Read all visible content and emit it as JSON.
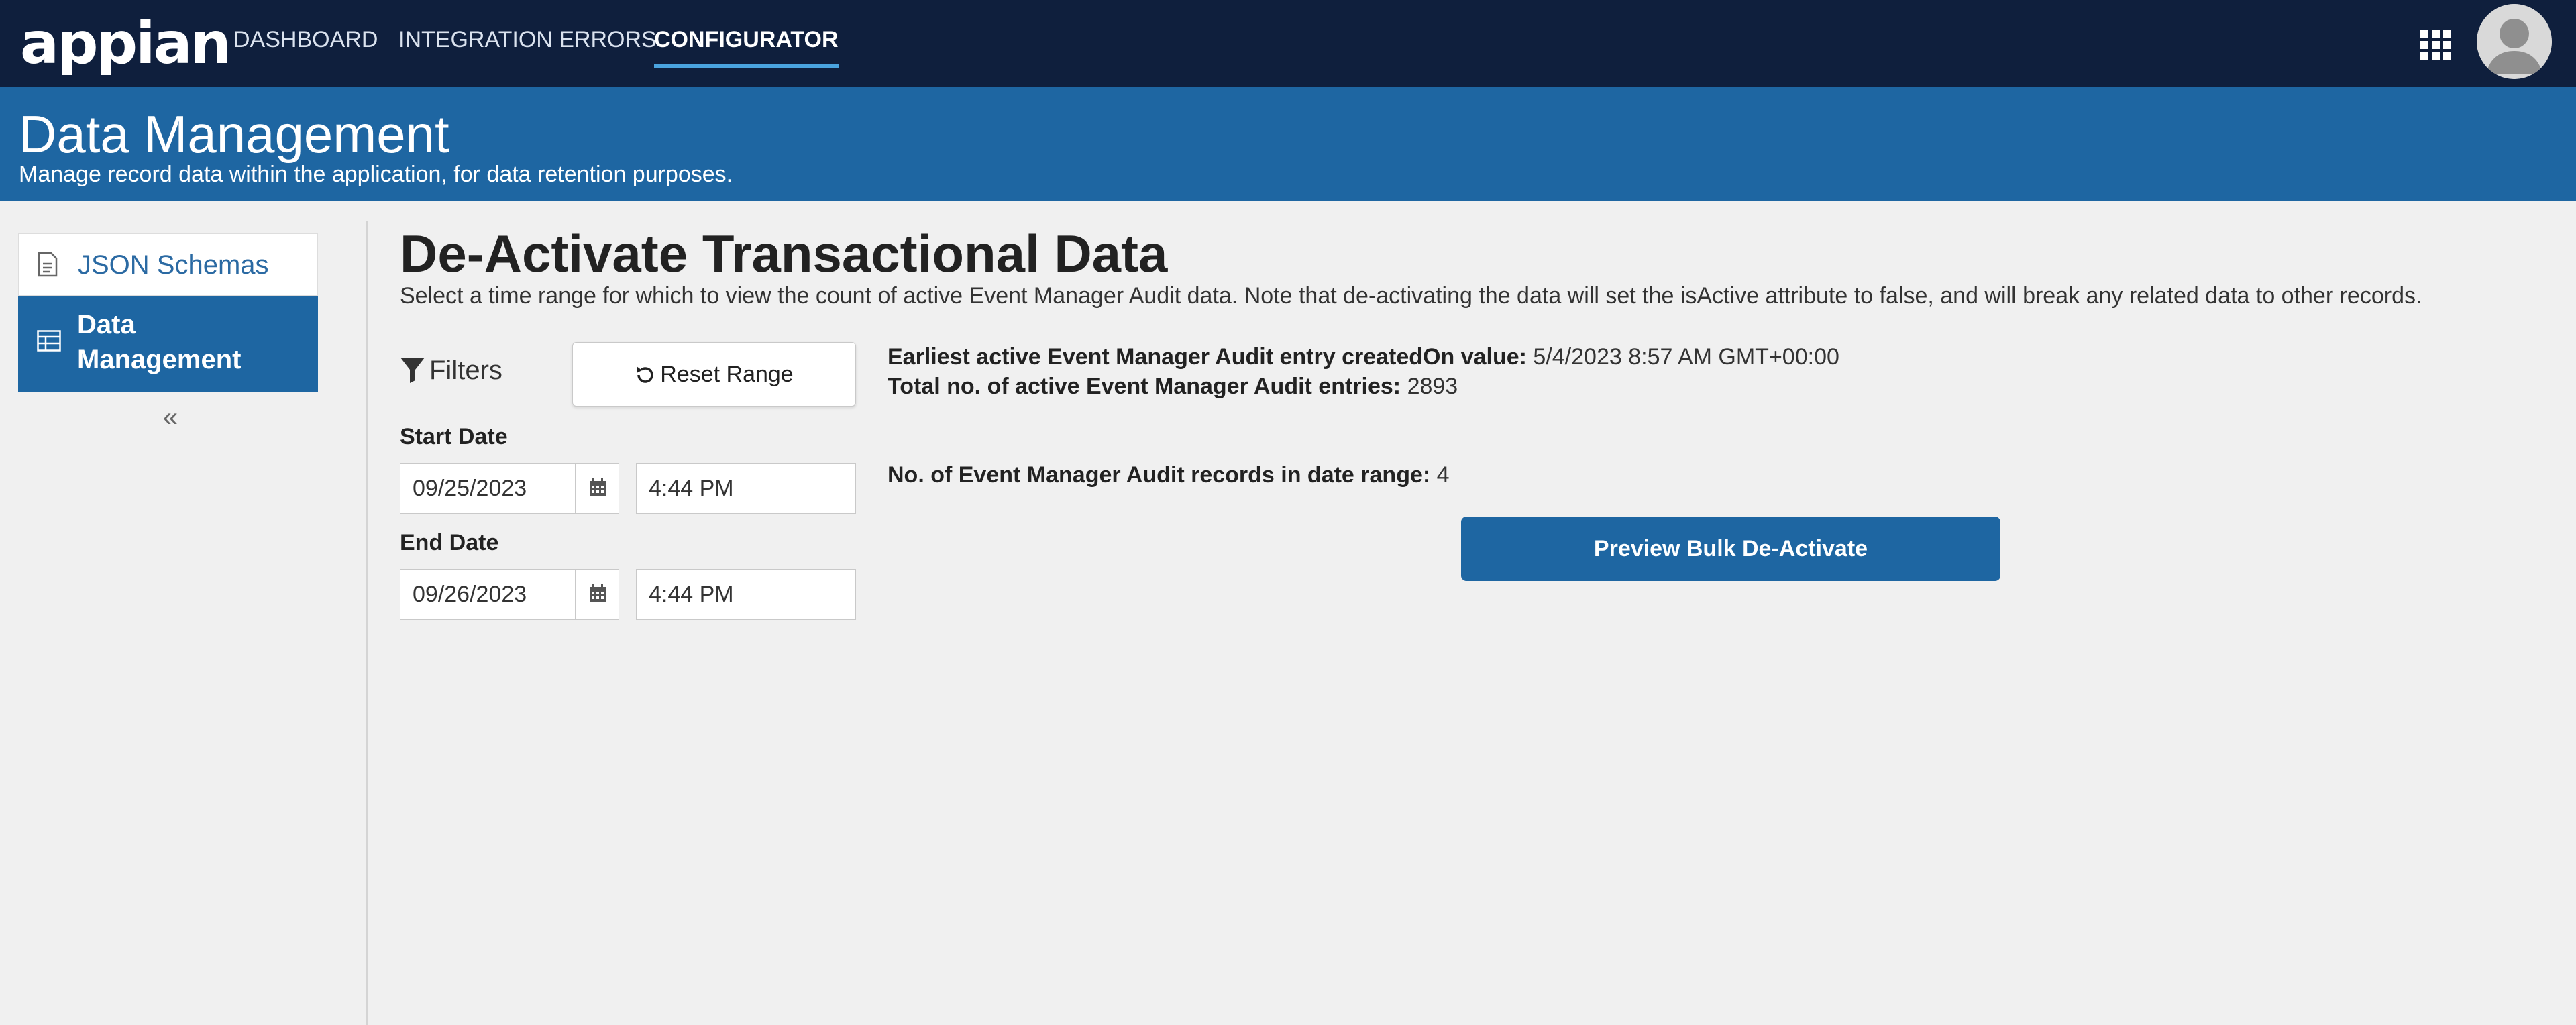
{
  "app": {
    "logo_text": "appian"
  },
  "nav": {
    "dashboard": "DASHBOARD",
    "integration_errors": "INTEGRATION ERRORS",
    "configurator": "CONFIGURATOR"
  },
  "header": {
    "title": "Data Management",
    "subtitle": "Manage record data within the application, for data retention purposes."
  },
  "sidebar": {
    "items": [
      {
        "label": "JSON Schemas",
        "icon": "document-icon"
      },
      {
        "label": "Data Management",
        "icon": "table-icon"
      }
    ],
    "collapse": "«"
  },
  "main": {
    "title": "De-Activate Transactional Data",
    "description": "Select a time range for which to view the count of active Event Manager Audit data. Note that de-activating the data will set the isActive attribute to false, and will break any related data to other records.",
    "filters_label": "Filters",
    "reset_label": "Reset Range",
    "start_date_label": "Start Date",
    "start_date": "09/25/2023",
    "start_time": "4:44 PM",
    "end_date_label": "End Date",
    "end_date": "09/26/2023",
    "end_time": "4:44 PM",
    "earliest_label": "Earliest active Event Manager Audit entry createdOn value:",
    "earliest_value": "5/4/2023 8:57 AM GMT+00:00",
    "total_label": "Total no. of active Event Manager Audit entries:",
    "total_value": "2893",
    "range_label": "No. of Event Manager Audit records in date range:",
    "range_value": "4",
    "preview_button": "Preview Bulk De-Activate"
  },
  "colors": {
    "nav_bg": "#0f1f3d",
    "band_bg": "#1e66a2",
    "accent": "#4aa3df"
  }
}
